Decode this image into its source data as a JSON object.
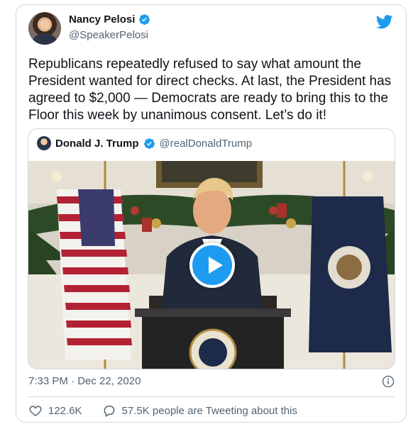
{
  "author": {
    "name": "Nancy Pelosi",
    "handle": "@SpeakerPelosi"
  },
  "tweet": {
    "text": "Republicans repeatedly refused to say what amount the President wanted for direct checks. At last, the President has agreed to $2,000 — Democrats are ready to bring this to the Floor this week by unanimous consent. Let’s do it!",
    "timestamp": "7:33 PM · Dec 22, 2020"
  },
  "quoted_tweet": {
    "name": "Donald J. Trump",
    "handle": "@realDonaldTrump"
  },
  "footer": {
    "likes": "122.6K",
    "conversation": "57.5K people are Tweeting about this"
  },
  "colors": {
    "accent": "#1d9bf0",
    "text": "#0f1419",
    "muted": "#536471",
    "border": "#cfd9de"
  },
  "icons": [
    "verified-badge-icon",
    "twitter-bird-icon",
    "play-icon",
    "info-icon",
    "heart-icon",
    "speech-bubble-icon"
  ]
}
